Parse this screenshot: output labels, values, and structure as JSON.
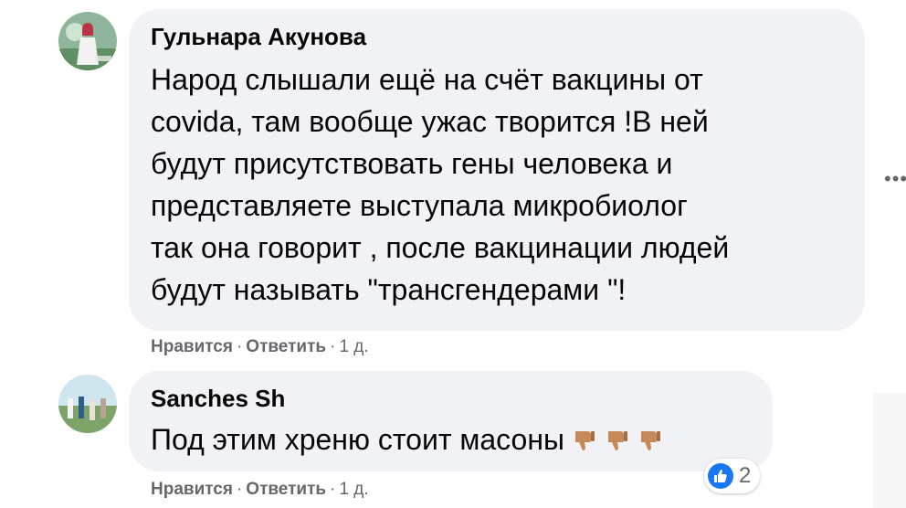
{
  "comments": [
    {
      "author": "Гульнара Акунова",
      "text": "Народ слышали ещё на счёт вакцины от\ncovida, там вообще ужас творится !В ней\nбудут присутствовать гены человека и\nпредставляете выступала микробиолог\nтак она говорит , после вакцинации людей\nбудут называть \"трансгендерами \"!",
      "actions": {
        "like": "Нравится",
        "reply": "Ответить",
        "time": "1 д."
      }
    },
    {
      "author": "Sanches Sh",
      "text": "Под этим хреню стоит масоны",
      "actions": {
        "like": "Нравится",
        "reply": "Ответить",
        "time": "1 д."
      },
      "reactions": {
        "icon": "thumbs-up-icon",
        "count": "2"
      }
    }
  ],
  "more_icon": "•••",
  "colors": {
    "bubble": "#f0f2f5",
    "meta": "#65676b",
    "like": "#1877f2"
  }
}
